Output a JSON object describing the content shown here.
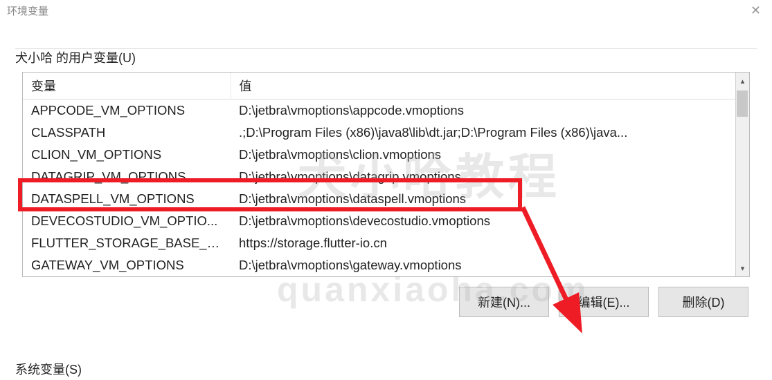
{
  "window": {
    "title": "环境变量"
  },
  "section": {
    "label": "犬小哈 的用户变量(U)"
  },
  "table": {
    "headers": {
      "variable": "变量",
      "value": "值"
    },
    "rows": [
      {
        "var": "APPCODE_VM_OPTIONS",
        "val": "D:\\jetbra\\vmoptions\\appcode.vmoptions"
      },
      {
        "var": "CLASSPATH",
        "val": ".;D:\\Program Files (x86)\\java8\\lib\\dt.jar;D:\\Program Files (x86)\\java..."
      },
      {
        "var": "CLION_VM_OPTIONS",
        "val": "D:\\jetbra\\vmoptions\\clion.vmoptions"
      },
      {
        "var": "DATAGRIP_VM_OPTIONS",
        "val": "D:\\jetbra\\vmoptions\\datagrip.vmoptions"
      },
      {
        "var": "DATASPELL_VM_OPTIONS",
        "val": "D:\\jetbra\\vmoptions\\dataspell.vmoptions"
      },
      {
        "var": "DEVECOSTUDIO_VM_OPTIO...",
        "val": "D:\\jetbra\\vmoptions\\devecostudio.vmoptions"
      },
      {
        "var": "FLUTTER_STORAGE_BASE_URL",
        "val": "https://storage.flutter-io.cn"
      },
      {
        "var": "GATEWAY_VM_OPTIONS",
        "val": "D:\\jetbra\\vmoptions\\gateway.vmoptions"
      }
    ]
  },
  "buttons": {
    "new": "新建(N)...",
    "edit": "编辑(E)...",
    "delete": "删除(D)"
  },
  "system_section": {
    "label": "系统变量(S)"
  },
  "watermarks": {
    "w1": "犬小哈教程",
    "w2": "quanxiaoha.com"
  },
  "annotation": {
    "highlighted_variable": "DATAGRIP_VM_OPTIONS",
    "arrow_target": "编辑(E)..."
  }
}
